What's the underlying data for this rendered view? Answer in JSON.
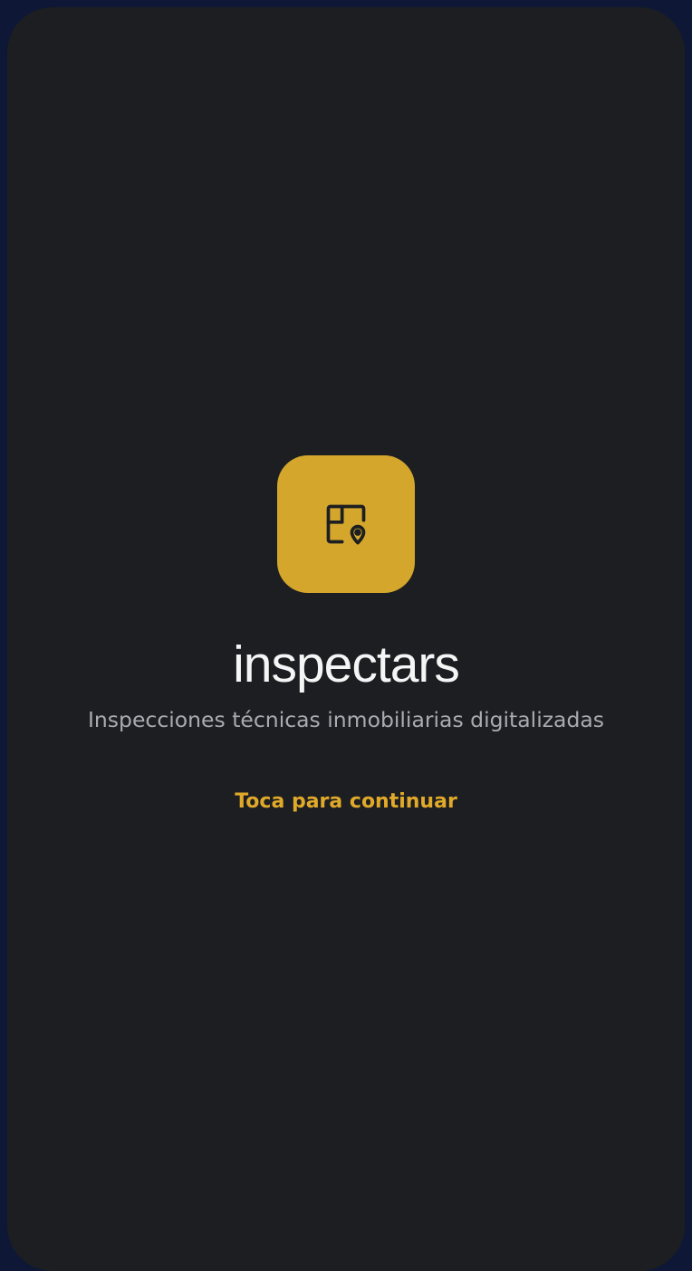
{
  "app": {
    "name": "inspectars",
    "tagline": "Inspecciones técnicas inmobiliarias digitalizadas",
    "cta_label": "Toca para continuar"
  },
  "icons": {
    "logo": "floor-plan-location-pin-icon"
  },
  "colors": {
    "frame": "#0e1836",
    "background": "#1c1e21",
    "logo_tile": "#d4a72c",
    "logo_glyph": "#1c1e21",
    "title": "#f5f5f5",
    "tagline": "#a9abb0",
    "accent": "#e1a92a"
  }
}
